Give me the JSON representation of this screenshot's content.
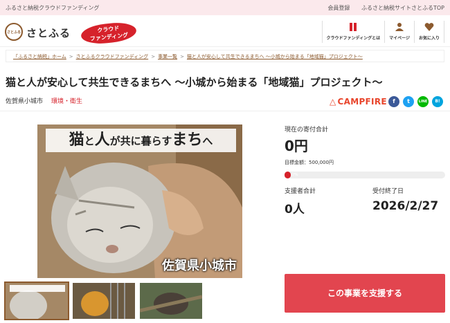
{
  "topbar": {
    "tagline": "ふるさと納税クラウドファンディング",
    "links": [
      "会員登録",
      "ふるさと納税サイトさとふるTOP"
    ]
  },
  "header": {
    "logo_mark": "さとふる",
    "logo_text": "さとふる",
    "badge_line1": "クラウド",
    "badge_line2": "ファンディング",
    "nav": [
      {
        "label": "クラウドファンディングとは",
        "icon": "book-icon"
      },
      {
        "label": "マイページ",
        "icon": "user-icon"
      },
      {
        "label": "お気に入り",
        "icon": "heart-icon"
      }
    ]
  },
  "breadcrumb": [
    "「ふるさと納税」ホーム",
    "さとふるクラウドファンディング",
    "事業一覧",
    "猫と人が安心して共生できるまちへ ～小城から始まる「地域猫」プロジェクト～"
  ],
  "project": {
    "title": "猫と人が安心して共生できるまちへ ～小城から始まる「地域猫」プロジェクト～",
    "municipality": "佐賀県小城市",
    "category": "環境・衛生",
    "partner": "CAMPFIRE"
  },
  "social": [
    "f",
    "t",
    "LINE",
    "B!"
  ],
  "hero": {
    "caption_a": "猫",
    "caption_b": "と",
    "caption_c": "人",
    "caption_d": "が共に暮らす",
    "caption_e": "まち",
    "caption_f": "へ",
    "place": "佐賀県小城市"
  },
  "funding": {
    "current_label": "現在の寄付合計",
    "current_amount": "0円",
    "goal_text": "目標金額：500,000円",
    "progress_percent": 0,
    "progress_label": "0%",
    "supporters_label": "支援者合計",
    "supporters_value": "0人",
    "deadline_label": "受付終了日",
    "deadline_value": "2026/2/27"
  },
  "cta_label": "この事業を支援する",
  "colors": {
    "accent": "#d6222b",
    "cta": "#e2454f",
    "brown": "#8c5a2e",
    "topbar": "#fbe9ec"
  }
}
